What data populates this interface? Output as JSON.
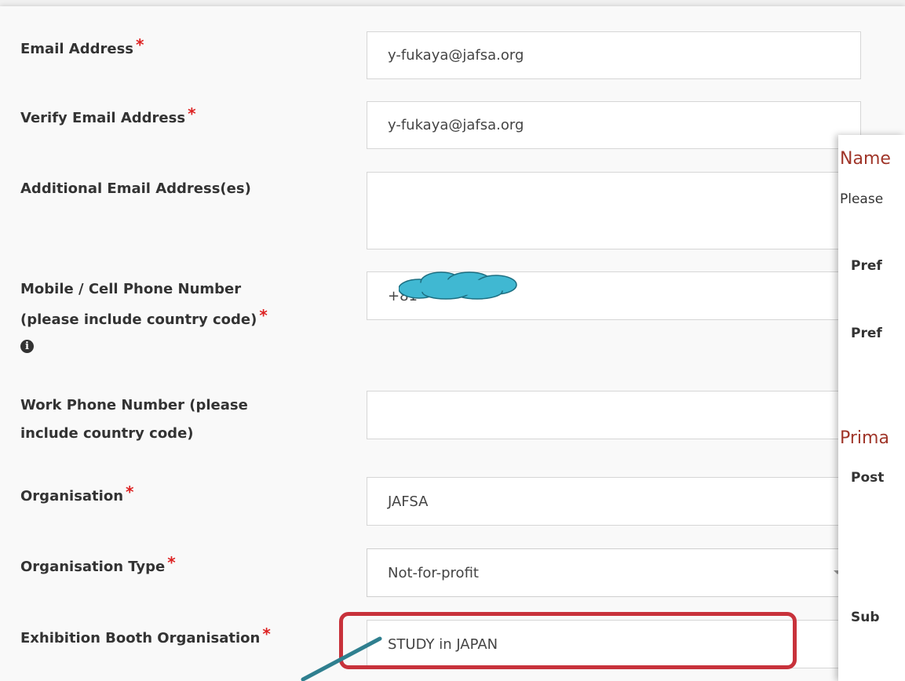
{
  "form": {
    "required_marker": "*",
    "fields": [
      {
        "label": "Email Address",
        "value": "y-fukaya@jafsa.org"
      },
      {
        "label": "Verify Email Address",
        "value": "y-fukaya@jafsa.org"
      },
      {
        "label": "Additional Email Address(es)",
        "value": ""
      },
      {
        "label_line1": "Mobile / Cell Phone Number",
        "label_line2": "(please include country code)",
        "value": "+81",
        "info_icon": "info-icon"
      },
      {
        "label_line1": "Work Phone Number (please",
        "label_line2": "include country code)",
        "value": ""
      },
      {
        "label": "Organisation",
        "value": "JAFSA"
      },
      {
        "label": "Organisation Type",
        "value": "Not-for-profit"
      },
      {
        "label": "Exhibition Booth Organisation",
        "value": "STUDY in JAPAN"
      }
    ]
  },
  "overlay": {
    "heading_name": "Name",
    "text_please": "Please",
    "label_pref_1": "Pref",
    "label_pref_2": "Pref",
    "heading_primary": "Prima",
    "label_post": "Post",
    "label_subu": "Sub"
  },
  "annotation": {
    "highlight_color": "#c8323b",
    "redaction_color": "#40b8d2",
    "callout_color": "#2f7f8f"
  }
}
